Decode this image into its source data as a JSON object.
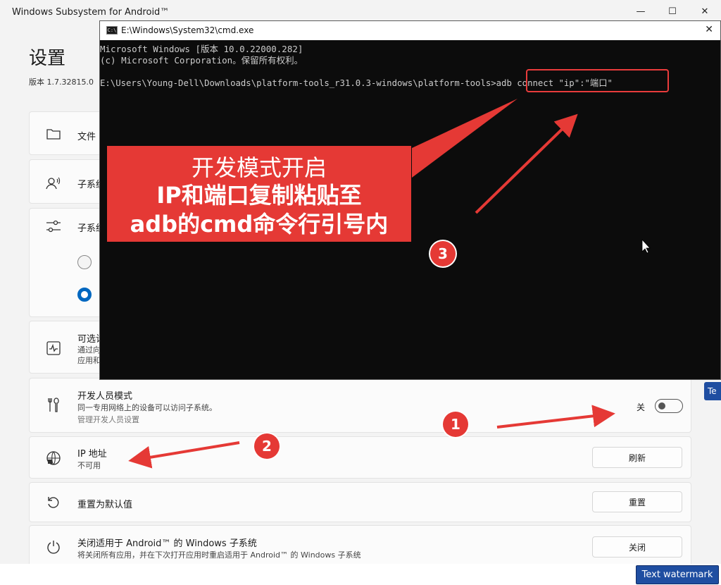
{
  "window": {
    "title": "Windows Subsystem for Android™",
    "minimize": "—",
    "maximize": "☐",
    "close": "✕"
  },
  "page": {
    "heading": "设置",
    "version": "版本 1.7.32815.0"
  },
  "rows": {
    "files": {
      "title": "文件"
    },
    "subsystem_resources": {
      "title": "子系统"
    },
    "subsystem_graphics": {
      "title": "子系统"
    },
    "optional": {
      "title": "可选诊",
      "sub": "通过向",
      "sub2": "应用和"
    },
    "developer_mode": {
      "title": "开发人员模式",
      "sub": "同一专用网络上的设备可以访问子系统。",
      "link": "管理开发人员设置",
      "toggle_label": "关",
      "toggle_on": false
    },
    "ip_address": {
      "title": "IP 地址",
      "sub": "不可用",
      "button": "刷新"
    },
    "reset": {
      "title": "重置为默认值",
      "button": "重置"
    },
    "shutdown": {
      "title": "关闭适用于 Android™ 的 Windows 子系统",
      "sub": "将关闭所有应用，并在下次打开应用时重启适用于 Android™ 的 Windows 子系统",
      "button": "关闭"
    }
  },
  "cmd": {
    "title": "E:\\Windows\\System32\\cmd.exe",
    "icon_text": "C:\\",
    "close": "✕",
    "lines": [
      "Microsoft Windows [版本 10.0.22000.282]",
      "(c) Microsoft Corporation。保留所有权利。",
      "E:\\Users\\Young-Dell\\Downloads\\platform-tools_r31.0.3-windows\\platform-tools>adb connect \"ip\":\"端口\""
    ]
  },
  "annotation": {
    "callout_line1": "开发模式开启",
    "callout_line2": "IP和端口复制粘贴至",
    "callout_line3": "adb的cmd命令行引号内",
    "step1": "1",
    "step2": "2",
    "step3": "3",
    "accent_color": "#e53935"
  },
  "watermark": {
    "button": "Text watermark",
    "side_tab": "Te"
  }
}
